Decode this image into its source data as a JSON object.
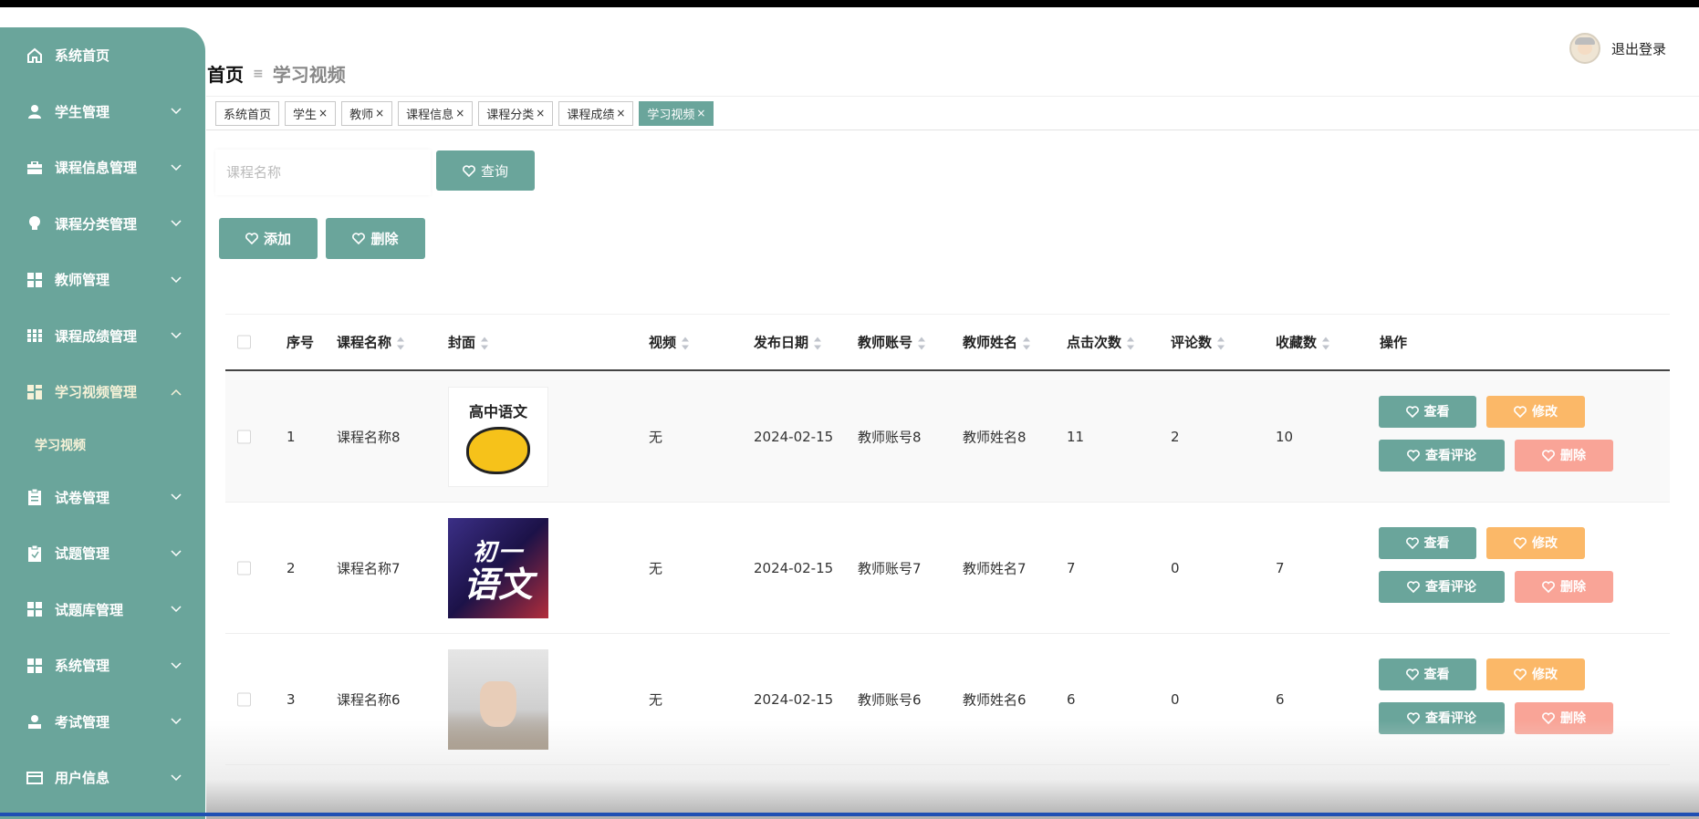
{
  "sidebar": {
    "items": [
      {
        "label": "系统首页",
        "icon": "home-icon",
        "chevron": false
      },
      {
        "label": "学生管理",
        "icon": "user-icon",
        "chevron": true
      },
      {
        "label": "课程信息管理",
        "icon": "briefcase-icon",
        "chevron": true
      },
      {
        "label": "课程分类管理",
        "icon": "bulb-icon",
        "chevron": true
      },
      {
        "label": "教师管理",
        "icon": "grid-icon",
        "chevron": true
      },
      {
        "label": "课程成绩管理",
        "icon": "grid9-icon",
        "chevron": true
      },
      {
        "label": "学习视频管理",
        "icon": "grid-icon",
        "chevron": true,
        "expanded": true
      },
      {
        "label": "试卷管理",
        "icon": "clipboard-icon",
        "chevron": true
      },
      {
        "label": "试题管理",
        "icon": "clipboard-icon",
        "chevron": true
      },
      {
        "label": "试题库管理",
        "icon": "grid-icon",
        "chevron": true
      },
      {
        "label": "系统管理",
        "icon": "grid-icon",
        "chevron": true
      },
      {
        "label": "考试管理",
        "icon": "user-icon",
        "chevron": true
      },
      {
        "label": "用户信息",
        "icon": "card-icon",
        "chevron": true
      }
    ],
    "sub_item": "学习视频"
  },
  "breadcrumb": {
    "home": "首页",
    "sep": "≡",
    "current": "学习视频"
  },
  "user": {
    "logout": "退出登录"
  },
  "tags": [
    {
      "label": "系统首页",
      "closable": false
    },
    {
      "label": "学生",
      "closable": true
    },
    {
      "label": "教师",
      "closable": true
    },
    {
      "label": "课程信息",
      "closable": true
    },
    {
      "label": "课程分类",
      "closable": true
    },
    {
      "label": "课程成绩",
      "closable": true
    },
    {
      "label": "学习视频",
      "closable": true,
      "active": true
    }
  ],
  "search": {
    "placeholder": "课程名称",
    "button": "查询"
  },
  "toolbar": {
    "add": "添加",
    "delete": "删除"
  },
  "table": {
    "headers": {
      "index": "序号",
      "name": "课程名称",
      "cover": "封面",
      "video": "视频",
      "date": "发布日期",
      "account": "教师账号",
      "teacher": "教师姓名",
      "clicks": "点击次数",
      "comments": "评论数",
      "favorites": "收藏数",
      "ops": "操作"
    },
    "rows": [
      {
        "index": "1",
        "name": "课程名称8",
        "cover_text": "高中语文",
        "video": "无",
        "date": "2024-02-15",
        "account": "教师账号8",
        "teacher": "教师姓名8",
        "clicks": "11",
        "comments": "2",
        "favorites": "10"
      },
      {
        "index": "2",
        "name": "课程名称7",
        "cover_text_a": "初一",
        "cover_text_b": "语文",
        "video": "无",
        "date": "2024-02-15",
        "account": "教师账号7",
        "teacher": "教师姓名7",
        "clicks": "7",
        "comments": "0",
        "favorites": "7"
      },
      {
        "index": "3",
        "name": "课程名称6",
        "video": "无",
        "date": "2024-02-15",
        "account": "教师账号6",
        "teacher": "教师姓名6",
        "clicks": "6",
        "comments": "0",
        "favorites": "6"
      }
    ],
    "actions": {
      "view": "查看",
      "edit": "修改",
      "comments": "查看评论",
      "delete": "删除"
    }
  },
  "colors": {
    "teal": "#6aa59b",
    "orange": "#fbb868",
    "pink": "#f9a497"
  }
}
